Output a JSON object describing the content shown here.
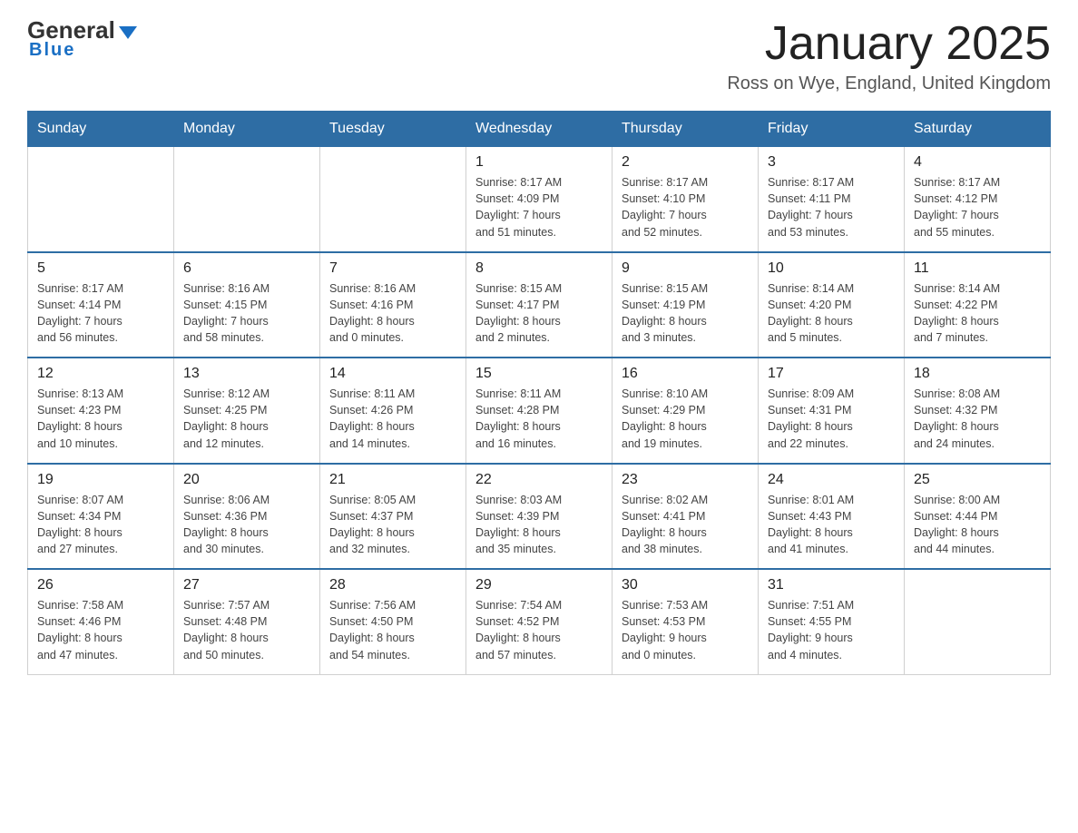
{
  "header": {
    "logo_general": "General",
    "logo_blue": "Blue",
    "title": "January 2025",
    "subtitle": "Ross on Wye, England, United Kingdom"
  },
  "days_of_week": [
    "Sunday",
    "Monday",
    "Tuesday",
    "Wednesday",
    "Thursday",
    "Friday",
    "Saturday"
  ],
  "weeks": [
    [
      {
        "num": "",
        "info": ""
      },
      {
        "num": "",
        "info": ""
      },
      {
        "num": "",
        "info": ""
      },
      {
        "num": "1",
        "info": "Sunrise: 8:17 AM\nSunset: 4:09 PM\nDaylight: 7 hours\nand 51 minutes."
      },
      {
        "num": "2",
        "info": "Sunrise: 8:17 AM\nSunset: 4:10 PM\nDaylight: 7 hours\nand 52 minutes."
      },
      {
        "num": "3",
        "info": "Sunrise: 8:17 AM\nSunset: 4:11 PM\nDaylight: 7 hours\nand 53 minutes."
      },
      {
        "num": "4",
        "info": "Sunrise: 8:17 AM\nSunset: 4:12 PM\nDaylight: 7 hours\nand 55 minutes."
      }
    ],
    [
      {
        "num": "5",
        "info": "Sunrise: 8:17 AM\nSunset: 4:14 PM\nDaylight: 7 hours\nand 56 minutes."
      },
      {
        "num": "6",
        "info": "Sunrise: 8:16 AM\nSunset: 4:15 PM\nDaylight: 7 hours\nand 58 minutes."
      },
      {
        "num": "7",
        "info": "Sunrise: 8:16 AM\nSunset: 4:16 PM\nDaylight: 8 hours\nand 0 minutes."
      },
      {
        "num": "8",
        "info": "Sunrise: 8:15 AM\nSunset: 4:17 PM\nDaylight: 8 hours\nand 2 minutes."
      },
      {
        "num": "9",
        "info": "Sunrise: 8:15 AM\nSunset: 4:19 PM\nDaylight: 8 hours\nand 3 minutes."
      },
      {
        "num": "10",
        "info": "Sunrise: 8:14 AM\nSunset: 4:20 PM\nDaylight: 8 hours\nand 5 minutes."
      },
      {
        "num": "11",
        "info": "Sunrise: 8:14 AM\nSunset: 4:22 PM\nDaylight: 8 hours\nand 7 minutes."
      }
    ],
    [
      {
        "num": "12",
        "info": "Sunrise: 8:13 AM\nSunset: 4:23 PM\nDaylight: 8 hours\nand 10 minutes."
      },
      {
        "num": "13",
        "info": "Sunrise: 8:12 AM\nSunset: 4:25 PM\nDaylight: 8 hours\nand 12 minutes."
      },
      {
        "num": "14",
        "info": "Sunrise: 8:11 AM\nSunset: 4:26 PM\nDaylight: 8 hours\nand 14 minutes."
      },
      {
        "num": "15",
        "info": "Sunrise: 8:11 AM\nSunset: 4:28 PM\nDaylight: 8 hours\nand 16 minutes."
      },
      {
        "num": "16",
        "info": "Sunrise: 8:10 AM\nSunset: 4:29 PM\nDaylight: 8 hours\nand 19 minutes."
      },
      {
        "num": "17",
        "info": "Sunrise: 8:09 AM\nSunset: 4:31 PM\nDaylight: 8 hours\nand 22 minutes."
      },
      {
        "num": "18",
        "info": "Sunrise: 8:08 AM\nSunset: 4:32 PM\nDaylight: 8 hours\nand 24 minutes."
      }
    ],
    [
      {
        "num": "19",
        "info": "Sunrise: 8:07 AM\nSunset: 4:34 PM\nDaylight: 8 hours\nand 27 minutes."
      },
      {
        "num": "20",
        "info": "Sunrise: 8:06 AM\nSunset: 4:36 PM\nDaylight: 8 hours\nand 30 minutes."
      },
      {
        "num": "21",
        "info": "Sunrise: 8:05 AM\nSunset: 4:37 PM\nDaylight: 8 hours\nand 32 minutes."
      },
      {
        "num": "22",
        "info": "Sunrise: 8:03 AM\nSunset: 4:39 PM\nDaylight: 8 hours\nand 35 minutes."
      },
      {
        "num": "23",
        "info": "Sunrise: 8:02 AM\nSunset: 4:41 PM\nDaylight: 8 hours\nand 38 minutes."
      },
      {
        "num": "24",
        "info": "Sunrise: 8:01 AM\nSunset: 4:43 PM\nDaylight: 8 hours\nand 41 minutes."
      },
      {
        "num": "25",
        "info": "Sunrise: 8:00 AM\nSunset: 4:44 PM\nDaylight: 8 hours\nand 44 minutes."
      }
    ],
    [
      {
        "num": "26",
        "info": "Sunrise: 7:58 AM\nSunset: 4:46 PM\nDaylight: 8 hours\nand 47 minutes."
      },
      {
        "num": "27",
        "info": "Sunrise: 7:57 AM\nSunset: 4:48 PM\nDaylight: 8 hours\nand 50 minutes."
      },
      {
        "num": "28",
        "info": "Sunrise: 7:56 AM\nSunset: 4:50 PM\nDaylight: 8 hours\nand 54 minutes."
      },
      {
        "num": "29",
        "info": "Sunrise: 7:54 AM\nSunset: 4:52 PM\nDaylight: 8 hours\nand 57 minutes."
      },
      {
        "num": "30",
        "info": "Sunrise: 7:53 AM\nSunset: 4:53 PM\nDaylight: 9 hours\nand 0 minutes."
      },
      {
        "num": "31",
        "info": "Sunrise: 7:51 AM\nSunset: 4:55 PM\nDaylight: 9 hours\nand 4 minutes."
      },
      {
        "num": "",
        "info": ""
      }
    ]
  ]
}
